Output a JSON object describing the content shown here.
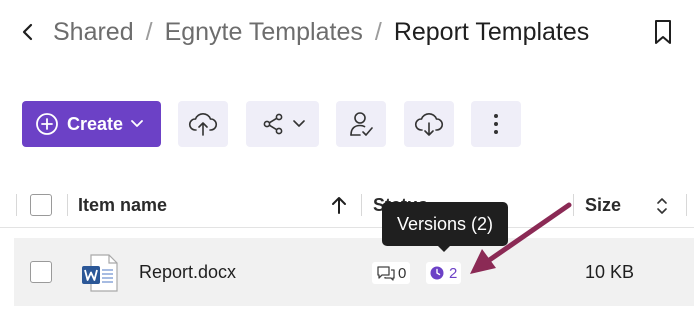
{
  "breadcrumb": {
    "items": [
      "Shared",
      "Egnyte Templates"
    ],
    "separator": "/",
    "current": "Report Templates"
  },
  "toolbar": {
    "create_label": "Create",
    "buttons": [
      "upload-icon",
      "share-icon",
      "user-check-icon",
      "download-icon",
      "more-icon"
    ]
  },
  "table": {
    "headers": {
      "name": "Item name",
      "status": "Status",
      "size": "Size"
    },
    "rows": [
      {
        "name": "Report.docx",
        "file_type": "word-doc-icon",
        "comments": "0",
        "versions": "2",
        "size": "10 KB"
      }
    ]
  },
  "tooltip": {
    "text": "Versions (2)"
  },
  "colors": {
    "accent": "#6c41c6",
    "toolbar_button_bg": "#efeef8",
    "row_bg": "#f1f1f1",
    "tooltip_bg": "#1f1f1f",
    "annotation_arrow": "#8b2a55",
    "word_blue": "#2b5797"
  }
}
